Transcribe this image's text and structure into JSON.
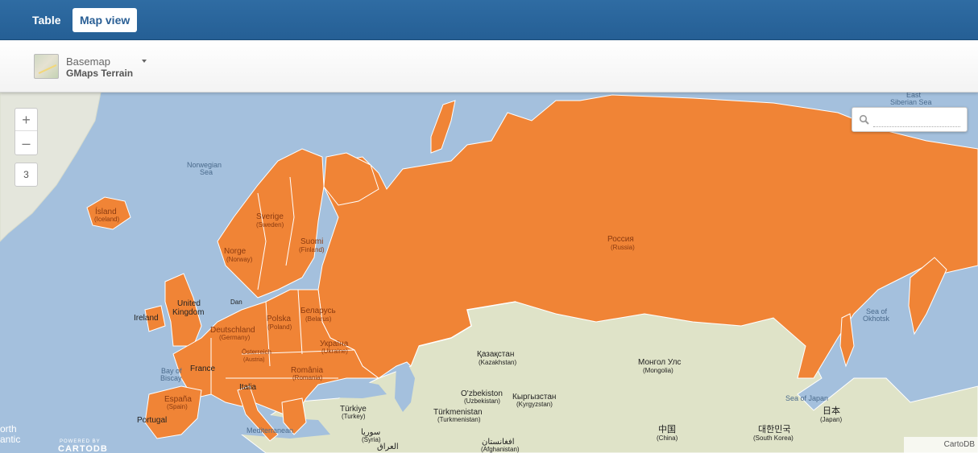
{
  "tabs": {
    "table": "Table",
    "map_view": "Map view"
  },
  "basemap": {
    "label": "Basemap",
    "value": "GMaps Terrain"
  },
  "controls": {
    "zoom_in": "+",
    "zoom_out": "–",
    "zoom_level": "3",
    "search_placeholder": ""
  },
  "attribution": "CartoDB",
  "logo": {
    "small": "POWERED BY",
    "big": "CARTODB"
  },
  "colors": {
    "highlight": "#f08436",
    "ocean": "#a4c0dd",
    "land": "#dfe3c8",
    "topbar": "#2a6399"
  },
  "map_labels": {
    "norwegian_sea_1": "Norwegian",
    "norwegian_sea_2": "Sea",
    "east_siberian_1": "East",
    "east_siberian_2": "Siberian Sea",
    "okhotsk_1": "Sea of",
    "okhotsk_2": "Okhotsk",
    "sea_of_japan": "Sea of Japan",
    "bay_of_biscay_1": "Bay of",
    "bay_of_biscay_2": "Biscay",
    "mediterranean": "Mediterranean",
    "north_atlantic_1": "orth",
    "north_atlantic_2": "antic",
    "russia_native": "Россия",
    "russia_en": "(Russia)",
    "finland_native": "Suomi",
    "finland_en": "(Finland)",
    "sweden_native": "Sverige",
    "sweden_en": "(Sweden)",
    "norway_native": "Norge",
    "norway_en": "(Norway)",
    "iceland_native": "Ísland",
    "iceland_en": "(Iceland)",
    "ireland": "Ireland",
    "uk_1": "United",
    "uk_2": "Kingdom",
    "germany_native": "Deutschland",
    "germany_en": "(Germany)",
    "poland_native": "Polska",
    "poland_en": "(Poland)",
    "belarus_native": "Беларусь",
    "belarus_en": "(Belarus)",
    "ukraine_native": "Україна",
    "ukraine_en": "(Ukraine)",
    "romania_native": "România",
    "romania_en": "(Romania)",
    "austria_native": "Österreich",
    "austria_en": "(Austria)",
    "france": "France",
    "italy": "Italia",
    "spain_native": "España",
    "spain_en": "(Spain)",
    "portugal": "Portugal",
    "turkey_native": "Türkiye",
    "turkey_en": "(Turkey)",
    "syria_native": "سوريا",
    "syria_en": "(Syria)",
    "iraq": "العراق",
    "kazakhstan_native": "Қазақстан",
    "kazakhstan_en": "(Kazakhstan)",
    "uzbekistan_native": "O'zbekiston",
    "uzbekistan_en": "(Uzbekistan)",
    "kyrgyzstan_native": "Кыргызстан",
    "kyrgyzstan_en": "(Kyrgyzstan)",
    "turkmenistan_native": "Türkmenistan",
    "turkmenistan_en": "(Turkmenistan)",
    "afghanistan_native": "افغانستان",
    "afghanistan_en": "(Afghanistan)",
    "mongolia_native": "Монгол Улс",
    "mongolia_en": "(Mongolia)",
    "china_native": "中国",
    "china_en": "(China)",
    "south_korea_native": "대한민국",
    "south_korea_en": "(South Korea)",
    "japan_native": "日本",
    "japan_en": "(Japan)",
    "denmark": "Dan"
  }
}
